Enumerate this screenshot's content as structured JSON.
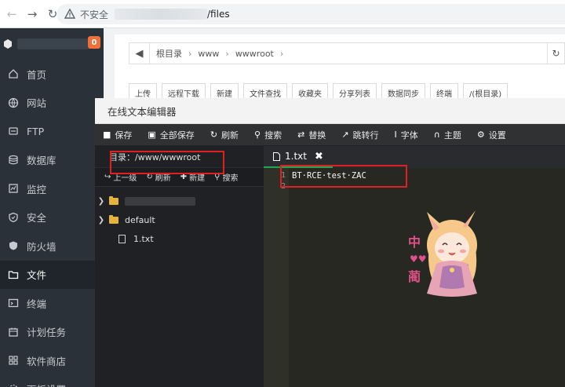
{
  "browser": {
    "insecure_label": "不安全",
    "url_path": "/files"
  },
  "sidebar": {
    "badge": "0",
    "items": [
      {
        "label": "首页",
        "icon": "home-icon"
      },
      {
        "label": "网站",
        "icon": "globe-icon"
      },
      {
        "label": "FTP",
        "icon": "ftp-icon"
      },
      {
        "label": "数据库",
        "icon": "database-icon"
      },
      {
        "label": "监控",
        "icon": "monitor-icon"
      },
      {
        "label": "安全",
        "icon": "shield-icon"
      },
      {
        "label": "防火墙",
        "icon": "firewall-icon"
      },
      {
        "label": "文件",
        "icon": "folder-icon",
        "active": true
      },
      {
        "label": "终端",
        "icon": "terminal-icon"
      },
      {
        "label": "计划任务",
        "icon": "calendar-icon"
      },
      {
        "label": "软件商店",
        "icon": "grid-icon"
      },
      {
        "label": "面板设置",
        "icon": "settings-icon"
      }
    ]
  },
  "filemanager": {
    "crumbs": [
      "根目录",
      "www",
      "wwwroot"
    ],
    "toolbar": [
      "上传",
      "远程下载",
      "新建",
      "文件查找",
      "收藏夹",
      "分享列表",
      "数据同步",
      "终端",
      "/(根目录)"
    ]
  },
  "editor": {
    "title": "在线文本编辑器",
    "toolbar": [
      {
        "label": "保存",
        "icon": "save-icon"
      },
      {
        "label": "全部保存",
        "icon": "save-all-icon"
      },
      {
        "label": "刷新",
        "icon": "refresh-icon"
      },
      {
        "label": "搜索",
        "icon": "search-icon"
      },
      {
        "label": "替换",
        "icon": "replace-icon"
      },
      {
        "label": "跳转行",
        "icon": "jump-icon"
      },
      {
        "label": "字体",
        "icon": "font-icon"
      },
      {
        "label": "主题",
        "icon": "theme-icon"
      },
      {
        "label": "设置",
        "icon": "gear-icon"
      }
    ],
    "dir_label": "目录：/www/wwwroot",
    "tree_actions": [
      {
        "label": "上一级",
        "icon": "up-icon"
      },
      {
        "label": "刷新",
        "icon": "refresh-icon"
      },
      {
        "label": "新建",
        "icon": "plus-icon"
      },
      {
        "label": "搜索",
        "icon": "search-icon"
      }
    ],
    "tree": [
      {
        "type": "folder",
        "name": ""
      },
      {
        "type": "folder",
        "name": "default"
      },
      {
        "type": "file",
        "name": "1.txt"
      }
    ],
    "tab": {
      "name": "1.txt"
    },
    "lines": [
      "1",
      "2"
    ],
    "code": "BT·RCE·test·ZAC"
  }
}
